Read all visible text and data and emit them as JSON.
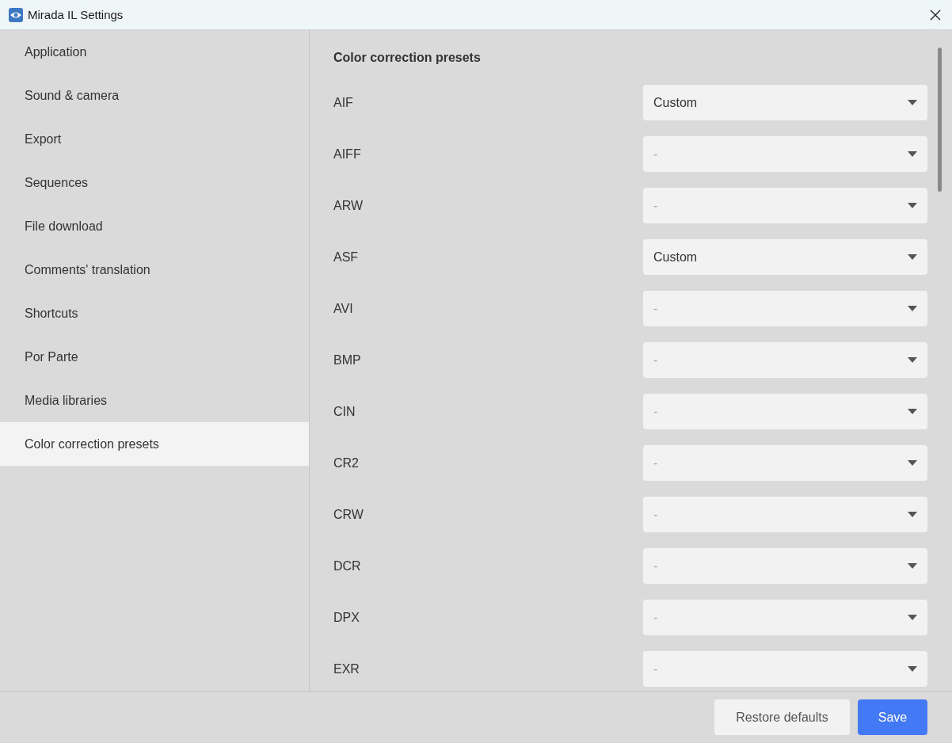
{
  "window": {
    "title": "Mirada IL Settings"
  },
  "sidebar": {
    "items": [
      {
        "label": "Application",
        "selected": false
      },
      {
        "label": "Sound & camera",
        "selected": false
      },
      {
        "label": "Export",
        "selected": false
      },
      {
        "label": "Sequences",
        "selected": false
      },
      {
        "label": "File download",
        "selected": false
      },
      {
        "label": "Comments' translation",
        "selected": false
      },
      {
        "label": "Shortcuts",
        "selected": false
      },
      {
        "label": "Por Parte",
        "selected": false
      },
      {
        "label": "Media libraries",
        "selected": false
      },
      {
        "label": "Color correction presets",
        "selected": true
      }
    ]
  },
  "content": {
    "heading": "Color correction presets",
    "rows": [
      {
        "label": "AIF",
        "value": "Custom"
      },
      {
        "label": "AIFF",
        "placeholder": "-"
      },
      {
        "label": "ARW",
        "placeholder": "-"
      },
      {
        "label": "ASF",
        "value": "Custom"
      },
      {
        "label": "AVI",
        "placeholder": "-"
      },
      {
        "label": "BMP",
        "placeholder": "-"
      },
      {
        "label": "CIN",
        "placeholder": "-"
      },
      {
        "label": "CR2",
        "placeholder": "-"
      },
      {
        "label": "CRW",
        "placeholder": "-"
      },
      {
        "label": "DCR",
        "placeholder": "-"
      },
      {
        "label": "DPX",
        "placeholder": "-"
      },
      {
        "label": "EXR",
        "placeholder": "-"
      }
    ]
  },
  "buttons": [
    {
      "label": "Restore defaults",
      "kind": "secondary"
    },
    {
      "label": "Save",
      "kind": "primary"
    }
  ]
}
